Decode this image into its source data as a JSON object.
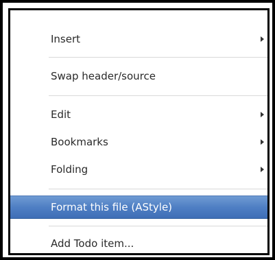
{
  "menu": {
    "items": [
      {
        "label": "Insert",
        "has_submenu": true
      },
      {
        "label": "Swap header/source",
        "has_submenu": false
      },
      {
        "label": "Edit",
        "has_submenu": true
      },
      {
        "label": "Bookmarks",
        "has_submenu": true
      },
      {
        "label": "Folding",
        "has_submenu": true
      },
      {
        "label": "Format this file (AStyle)",
        "has_submenu": false,
        "highlighted": true
      },
      {
        "label": "Add Todo item...",
        "has_submenu": false
      }
    ],
    "highlight_color": "#4f7fc4",
    "submenu_arrow_icon": "triangle-right-icon"
  }
}
